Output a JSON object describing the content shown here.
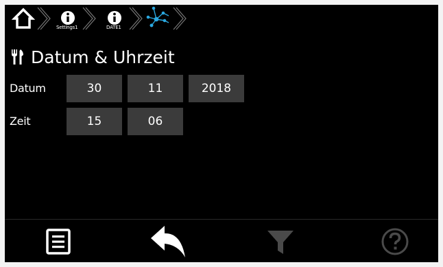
{
  "breadcrumb": {
    "home_icon": "home-icon",
    "items": [
      {
        "label": "Settings1",
        "icon": "info-icon"
      },
      {
        "label": "DATE1",
        "icon": "info-icon"
      },
      {
        "label": "",
        "icon": "network-icon"
      }
    ],
    "colors": {
      "accent": "#2aa8e0"
    }
  },
  "title": {
    "icon": "tools-icon",
    "text": "Datum & Uhrzeit"
  },
  "form": {
    "date": {
      "label": "Datum",
      "day": "30",
      "month": "11",
      "year": "2018"
    },
    "time": {
      "label": "Zeit",
      "hour": "15",
      "minute": "06"
    }
  },
  "bottom_bar": {
    "buttons": [
      {
        "name": "menu",
        "icon": "menu-list-icon",
        "enabled": true
      },
      {
        "name": "back",
        "icon": "undo-arrow-icon",
        "enabled": true
      },
      {
        "name": "filter",
        "icon": "filter-icon",
        "enabled": false
      },
      {
        "name": "help",
        "icon": "help-icon",
        "enabled": false
      }
    ]
  }
}
